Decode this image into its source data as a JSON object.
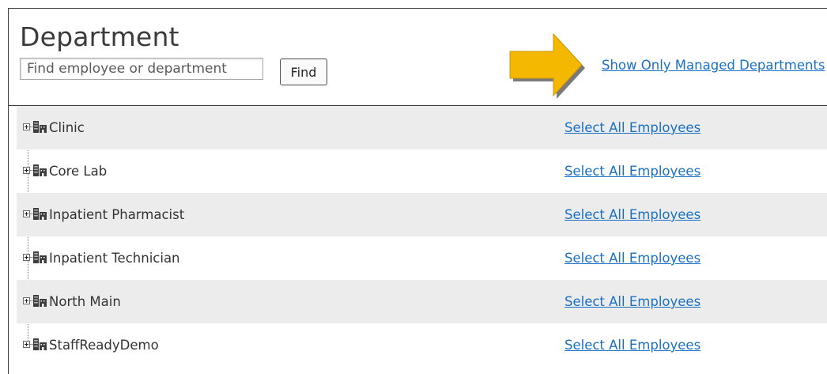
{
  "header": {
    "title": "Department",
    "search_placeholder": "Find employee or department",
    "search_value": "",
    "find_label": "Find",
    "managed_link": "Show Only Managed Departments"
  },
  "annotation": {
    "arrow_color": "#f5b800",
    "arrow_shadow": "#7a7a7a"
  },
  "colors": {
    "link": "#1a70c7",
    "row_shade": "#ececec",
    "text": "#333333"
  },
  "departments": [
    {
      "name": "Clinic",
      "action": "Select All Employees"
    },
    {
      "name": "Core Lab",
      "action": "Select All Employees"
    },
    {
      "name": "Inpatient Pharmacist",
      "action": "Select All Employees"
    },
    {
      "name": "Inpatient Technician",
      "action": "Select All Employees"
    },
    {
      "name": "North Main",
      "action": "Select All Employees"
    },
    {
      "name": "StaffReadyDemo",
      "action": "Select All Employees"
    }
  ]
}
